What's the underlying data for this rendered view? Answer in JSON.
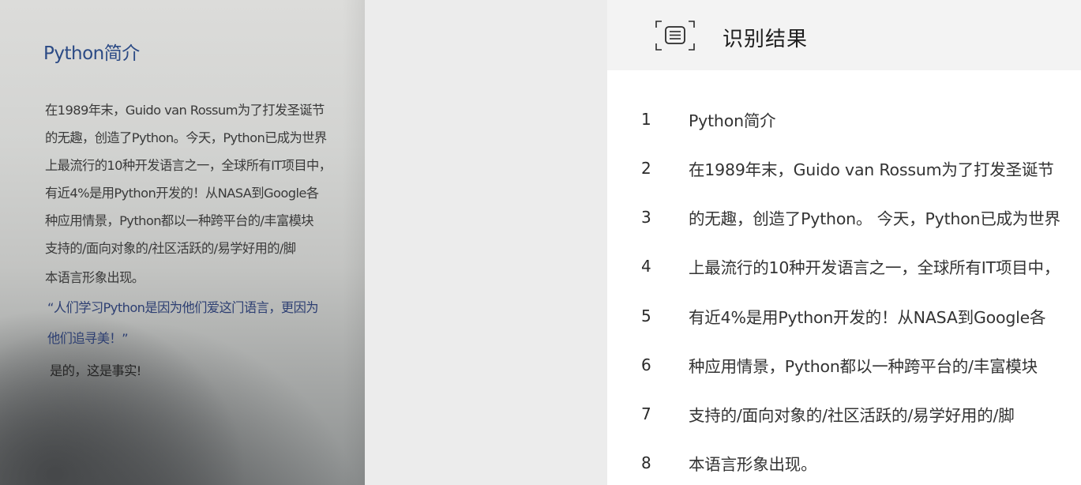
{
  "photo": {
    "title": "Python简介",
    "lines": [
      "在1989年末，Guido van Rossum为了打发圣诞节",
      "的无趣，创造了Python。今天，Python已成为世界",
      "上最流行的10种开发语言之一，全球所有IT项目中，",
      "有近4%是用Python开发的！从NASA到Google各",
      "种应用情景，Python都以一种跨平台的/丰富模块",
      "支持的/面向对象的/社区活跃的/易学好用的/脚",
      "本语言形象出现。"
    ],
    "quote_lines": [
      "“人们学习Python是因为他们爱这门语言，更因为",
      "他们追寻美！”"
    ],
    "final_line": "是的，这是事实!"
  },
  "result": {
    "title": "识别结果",
    "icon": "scan-document-icon",
    "rows": [
      {
        "num": "1",
        "text": "Python简介"
      },
      {
        "num": "2",
        "text": "在1989年末，Guido van Rossum为了打发圣诞节"
      },
      {
        "num": "3",
        "text": "的无趣，创造了Python。 今天，Python已成为世界"
      },
      {
        "num": "4",
        "text": "上最流行的10种开发语言之一，全球所有IT项目中，"
      },
      {
        "num": "5",
        "text": "有近4%是用Python开发的！从NASA到Google各"
      },
      {
        "num": "6",
        "text": "种应用情景，Python都以一种跨平台的/丰富模块"
      },
      {
        "num": "7",
        "text": "支持的/面向对象的/社区活跃的/易学好用的/脚"
      },
      {
        "num": "8",
        "text": "本语言形象出现。"
      }
    ]
  },
  "colors": {
    "title_blue": "#2b4a85",
    "quote_blue": "#2d3f72",
    "header_bg": "#f3f3f3",
    "gap_bg": "#ececec"
  }
}
